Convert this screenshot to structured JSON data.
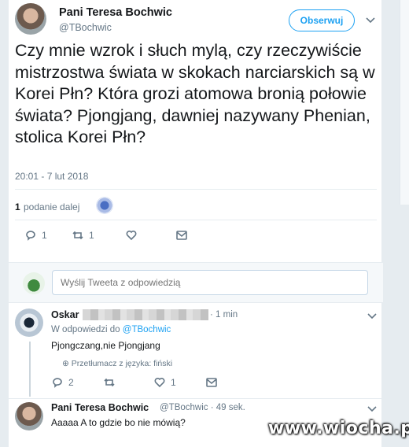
{
  "tweet": {
    "author_name": "Pani Teresa Bochwic",
    "author_handle": "@TBochwic",
    "follow_label": "Obserwuj",
    "menu_icon": "chevron-down-icon",
    "text": "Czy mnie wzrok i słuch mylą, czy rzeczywiście mistrzostwa świata w skokach narciarskich są w Korei Płn? Która grozi atomowa bronią połowie świata?  Pjongjang, dawniej nazywany Phenian, stolica Korei Płn?",
    "timestamp": "20:01 - 7 lut 2018",
    "retweet_count": "1",
    "retweet_label": "podanie dalej",
    "actions": {
      "replies": "1",
      "retweets": "1",
      "likes": "",
      "icons": [
        "reply-icon",
        "retweet-icon",
        "like-icon",
        "message-icon"
      ]
    }
  },
  "reply_box": {
    "placeholder": "Wyślij Tweeta z odpowiedzią"
  },
  "replies": [
    {
      "author_name": "Oskar",
      "time": "· 1 min",
      "in_reply_label": "W odpowiedzi do",
      "in_reply_handle": "@TBochwic",
      "text": "Pjongczang,nie Pjongjang",
      "translate_label": "Przetłumacz z języka: fiński",
      "actions": {
        "replies": "2",
        "retweets": "",
        "likes": "1"
      }
    },
    {
      "author_name": "Pani Teresa Bochwic",
      "author_handle": "@TBochwic",
      "time": "· 49 sek.",
      "text": "Aaaaa A to gdzie bo nie mówią?"
    }
  ],
  "watermark": "www.wiocha.pl",
  "colors": {
    "accent": "#1da1f2",
    "secondary_text": "#657786",
    "background": "#e6ecf0"
  }
}
